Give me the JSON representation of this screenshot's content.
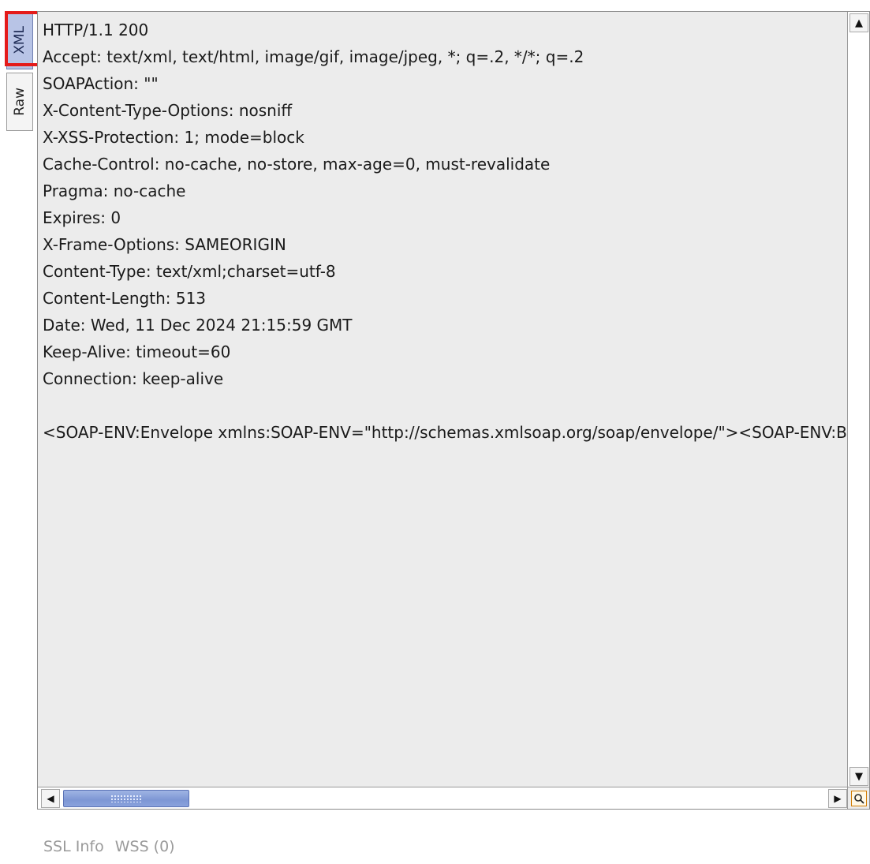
{
  "side_tabs": {
    "xml_label": "XML",
    "raw_label": "Raw"
  },
  "editor": {
    "lines": [
      "HTTP/1.1 200",
      "Accept: text/xml, text/html, image/gif, image/jpeg, *; q=.2, */*; q=.2",
      "SOAPAction: \"\"",
      "X-Content-Type-Options: nosniff",
      "X-XSS-Protection: 1; mode=block",
      "Cache-Control: no-cache, no-store, max-age=0, must-revalidate",
      "Pragma: no-cache",
      "Expires: 0",
      "X-Frame-Options: SAMEORIGIN",
      "Content-Type: text/xml;charset=utf-8",
      "Content-Length: 513",
      "Date: Wed, 11 Dec 2024 21:15:59 GMT",
      "Keep-Alive: timeout=60",
      "Connection: keep-alive",
      "",
      "<SOAP-ENV:Envelope xmlns:SOAP-ENV=\"http://schemas.xmlsoap.org/soap/envelope/\"><SOAP-ENV:Body>"
    ]
  },
  "bottom_tabs": {
    "ssl_info": "SSL Info",
    "wss": "WSS (0)"
  },
  "colors": {
    "highlight": "#e41b1b",
    "selected_tab": "#b8c4e6",
    "scroll_thumb": "#7d96d4"
  }
}
